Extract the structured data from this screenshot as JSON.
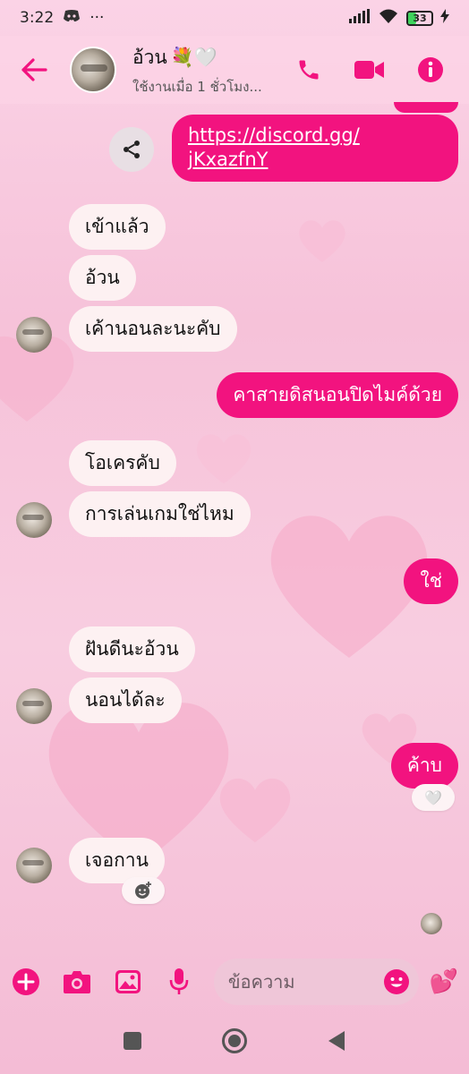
{
  "status_bar": {
    "time": "3:22",
    "more": "···",
    "battery": "33",
    "battery_level": 0.33
  },
  "header": {
    "name": "อ้วน",
    "name_emoji": "💐🤍",
    "subtitle": "ใช้งานเมื่อ 1 ชั่วโมง..."
  },
  "messages": [
    {
      "id": "m1",
      "from": "out",
      "text_line1": "https://discord.gg/",
      "text_line2": "jKxazfnY",
      "is_link": true
    },
    {
      "id": "m2",
      "from": "in",
      "text": "เข้าแล้ว"
    },
    {
      "id": "m3",
      "from": "in",
      "text": "อ้วน"
    },
    {
      "id": "m4",
      "from": "in",
      "text": "เค้านอนละนะคับ"
    },
    {
      "id": "m5",
      "from": "out",
      "text": "คาสายดิสนอนปิดไมค์ด้วย"
    },
    {
      "id": "m6",
      "from": "in",
      "text": "โอเครคับ"
    },
    {
      "id": "m7",
      "from": "in",
      "text": "การเล่นเกมใช่ไหม"
    },
    {
      "id": "m8",
      "from": "out",
      "text": "ใช่"
    },
    {
      "id": "m9",
      "from": "in",
      "text": "ฝันดีนะอ้วน"
    },
    {
      "id": "m10",
      "from": "in",
      "text": "นอนได้ละ"
    },
    {
      "id": "m11",
      "from": "out",
      "text": "ค้าบ",
      "reaction": "🤍"
    },
    {
      "id": "m12",
      "from": "in",
      "text": "เจอกาน"
    }
  ],
  "composer": {
    "placeholder": "ข้อความ",
    "send_emoji": "💕"
  },
  "colors": {
    "accent": "#f2137f",
    "incoming_bubble": "#fdf1f2",
    "background": "#f8cde0"
  },
  "icons": [
    "back-arrow-icon",
    "phone-icon",
    "video-icon",
    "info-icon",
    "share-icon",
    "plus-icon",
    "camera-icon",
    "image-icon",
    "mic-icon",
    "emoji-icon",
    "add-reaction-icon",
    "square-nav-icon",
    "circle-nav-icon",
    "triangle-nav-icon"
  ]
}
